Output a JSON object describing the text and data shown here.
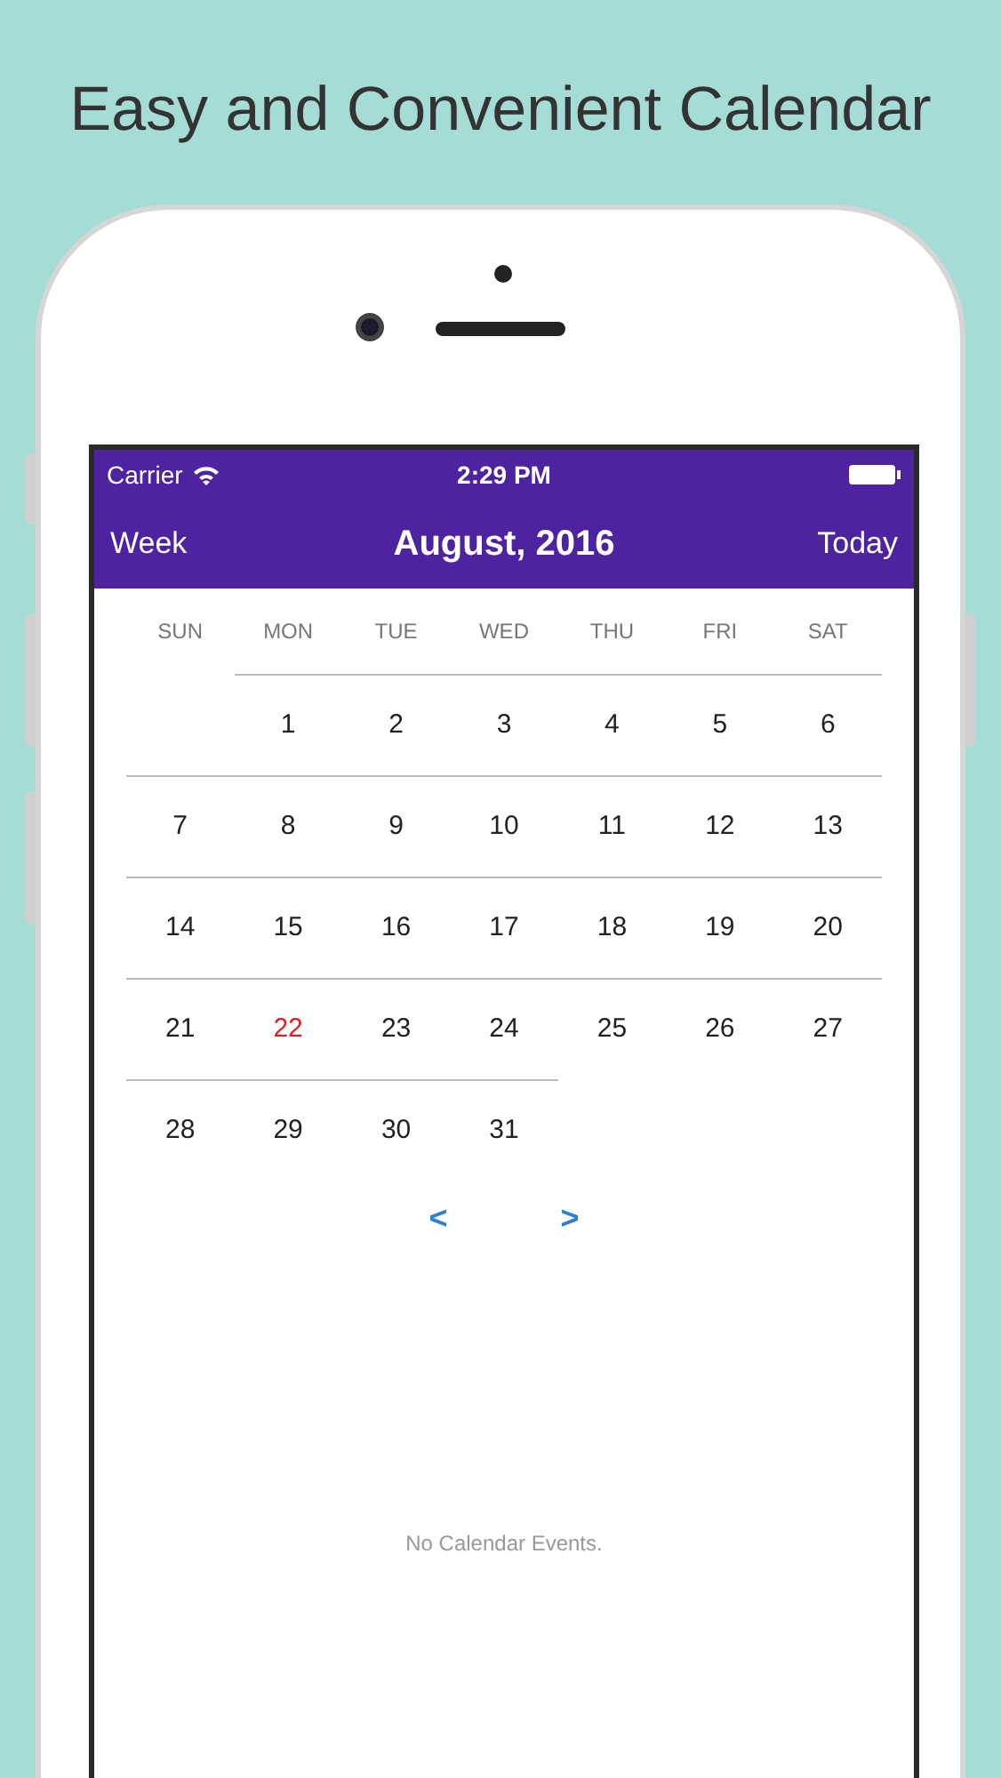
{
  "headline": "Easy and Convenient Calendar",
  "status_bar": {
    "carrier": "Carrier",
    "time": "2:29 PM"
  },
  "nav": {
    "left": "Week",
    "title": "August, 2016",
    "right": "Today"
  },
  "weekdays": [
    "SUN",
    "MON",
    "TUE",
    "WED",
    "THU",
    "FRI",
    "SAT"
  ],
  "weeks": [
    [
      {
        "kind": "blank"
      },
      {
        "label": "1",
        "today": false
      },
      {
        "label": "2",
        "today": false
      },
      {
        "label": "3",
        "today": false
      },
      {
        "label": "4",
        "today": false
      },
      {
        "label": "5",
        "today": false
      },
      {
        "label": "6",
        "today": false
      }
    ],
    [
      {
        "label": "7",
        "today": false
      },
      {
        "label": "8",
        "today": false
      },
      {
        "label": "9",
        "today": false
      },
      {
        "label": "10",
        "today": false
      },
      {
        "label": "11",
        "today": false
      },
      {
        "label": "12",
        "today": false
      },
      {
        "label": "13",
        "today": false
      }
    ],
    [
      {
        "label": "14",
        "today": false
      },
      {
        "label": "15",
        "today": false
      },
      {
        "label": "16",
        "today": false
      },
      {
        "label": "17",
        "today": false
      },
      {
        "label": "18",
        "today": false
      },
      {
        "label": "19",
        "today": false
      },
      {
        "label": "20",
        "today": false
      }
    ],
    [
      {
        "label": "21",
        "today": false
      },
      {
        "label": "22",
        "today": true
      },
      {
        "label": "23",
        "today": false
      },
      {
        "label": "24",
        "today": false
      },
      {
        "label": "25",
        "today": false
      },
      {
        "label": "26",
        "today": false
      },
      {
        "label": "27",
        "today": false
      }
    ],
    [
      {
        "label": "28",
        "today": false
      },
      {
        "label": "29",
        "today": false
      },
      {
        "label": "30",
        "today": false
      },
      {
        "label": "31",
        "today": false
      }
    ]
  ],
  "pager": {
    "previous": "<",
    "next": ">"
  },
  "empty_message": "No Calendar Events."
}
